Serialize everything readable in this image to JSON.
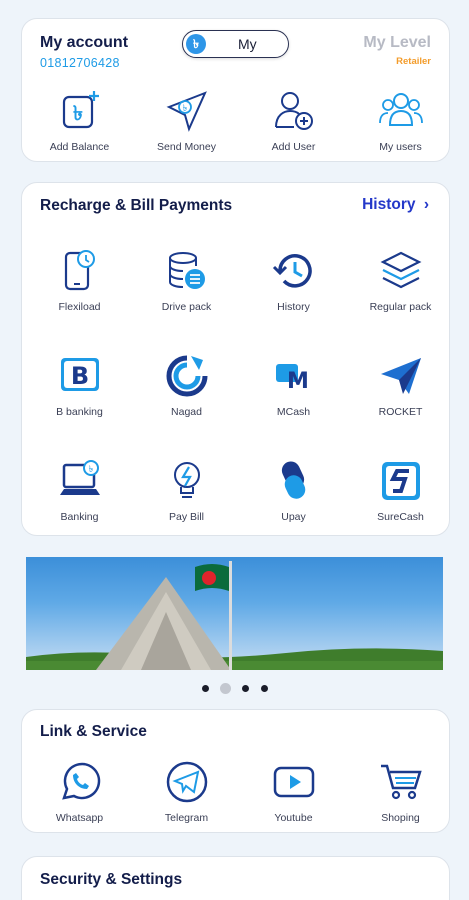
{
  "account": {
    "title": "My account",
    "phone": "01812706428",
    "toggle_symbol": "৳",
    "toggle_label": "My",
    "level_title": "My Level",
    "level_value": "Retailer",
    "actions": [
      {
        "label": "Add Balance",
        "icon": "add-balance-icon"
      },
      {
        "label": "Send Money",
        "icon": "send-money-icon"
      },
      {
        "label": "Add User",
        "icon": "add-user-icon"
      },
      {
        "label": "My users",
        "icon": "my-users-icon"
      }
    ]
  },
  "recharge": {
    "title": "Recharge & Bill Payments",
    "history_link": "History",
    "items": [
      {
        "label": "Flexiload",
        "icon": "flexiload-icon"
      },
      {
        "label": "Drive pack",
        "icon": "drive-pack-icon"
      },
      {
        "label": "History",
        "icon": "history-icon"
      },
      {
        "label": "Regular pack",
        "icon": "regular-pack-icon"
      },
      {
        "label": "B banking",
        "icon": "b-banking-icon"
      },
      {
        "label": "Nagad",
        "icon": "nagad-icon"
      },
      {
        "label": "MCash",
        "icon": "mcash-icon"
      },
      {
        "label": "ROCKET",
        "icon": "rocket-icon"
      },
      {
        "label": "Banking",
        "icon": "banking-icon"
      },
      {
        "label": "Pay Bill",
        "icon": "pay-bill-icon"
      },
      {
        "label": "Upay",
        "icon": "upay-icon"
      },
      {
        "label": "SureCash",
        "icon": "surecash-icon"
      }
    ]
  },
  "banner": {
    "slides": 4,
    "active_slide": 2
  },
  "links": {
    "title": "Link & Service",
    "items": [
      {
        "label": "Whatsapp",
        "icon": "whatsapp-icon"
      },
      {
        "label": "Telegram",
        "icon": "telegram-icon"
      },
      {
        "label": "Youtube",
        "icon": "youtube-icon"
      },
      {
        "label": "Shoping",
        "icon": "shopping-cart-icon"
      }
    ]
  },
  "security": {
    "title": "Security & Settings"
  },
  "colors": {
    "accent": "#1e9be6",
    "brand_dark": "#1b3a8c",
    "link": "#2438c9",
    "level": "#f39c2b"
  }
}
